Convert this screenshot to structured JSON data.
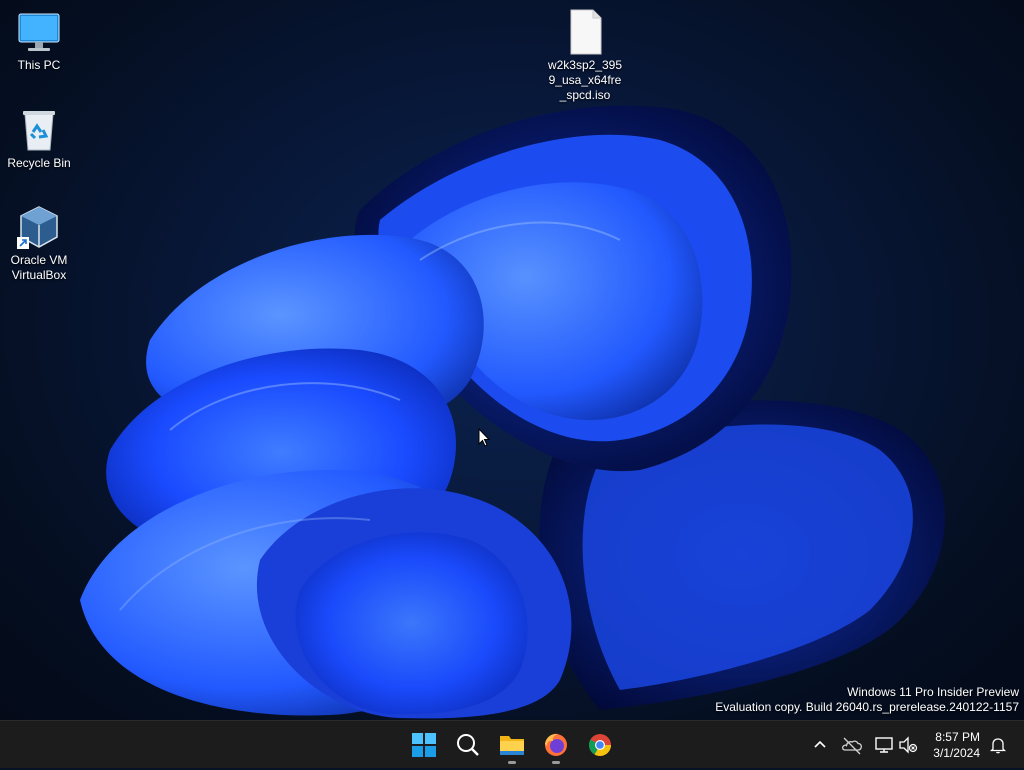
{
  "desktop": {
    "icons": [
      {
        "label": "This PC",
        "icon": "this-pc-icon"
      },
      {
        "label": "Recycle Bin",
        "icon": "recycle-bin-icon"
      },
      {
        "label": "Oracle VM VirtualBox",
        "icon": "virtualbox-icon"
      },
      {
        "label": "w2k3sp2_3959_usa_x64fre_spcd.iso",
        "icon": "iso-file-icon"
      }
    ],
    "watermark": {
      "line1": "Windows 11 Pro Insider Preview",
      "line2": "Evaluation copy. Build 26040.rs_prerelease.240122-1157"
    }
  },
  "taskbar": {
    "apps": [
      {
        "name": "Start",
        "icon": "windows-start-icon",
        "running": false
      },
      {
        "name": "Search",
        "icon": "search-icon",
        "running": false
      },
      {
        "name": "File Explorer",
        "icon": "file-explorer-icon",
        "running": true
      },
      {
        "name": "Firefox",
        "icon": "firefox-icon",
        "running": true
      },
      {
        "name": "Chrome",
        "icon": "chrome-icon",
        "running": false
      }
    ],
    "tray": {
      "icons": [
        "chevron-up-icon",
        "onedrive-icon",
        "network-icon",
        "volume-muted-icon",
        "notification-bell-icon"
      ],
      "time": "8:57 PM",
      "date": "3/1/2024"
    }
  },
  "colors": {
    "taskbar_bg": "#1c1c1c",
    "bloom_blue": "#1a4bff",
    "desktop_bg": "#071226"
  }
}
